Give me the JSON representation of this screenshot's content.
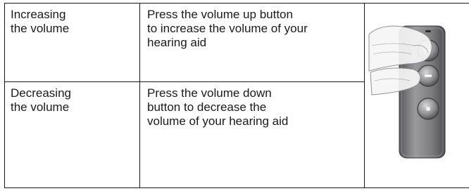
{
  "rows": [
    {
      "action": "Increasing\nthe volume",
      "description": "Press the volume up button\nto increase the volume of your\nhearing aid"
    },
    {
      "action": "Decreasing\nthe volume",
      "description": "Press the volume down\nbutton to decrease the\nvolume of your hearing aid"
    }
  ],
  "image": {
    "icon": "remote-control-with-hand-illustration",
    "colors": {
      "body": "#8a8a8c",
      "body_dark": "#5a5a5c",
      "button": "#9a9a9c",
      "hand": "#f4f4f4"
    }
  }
}
